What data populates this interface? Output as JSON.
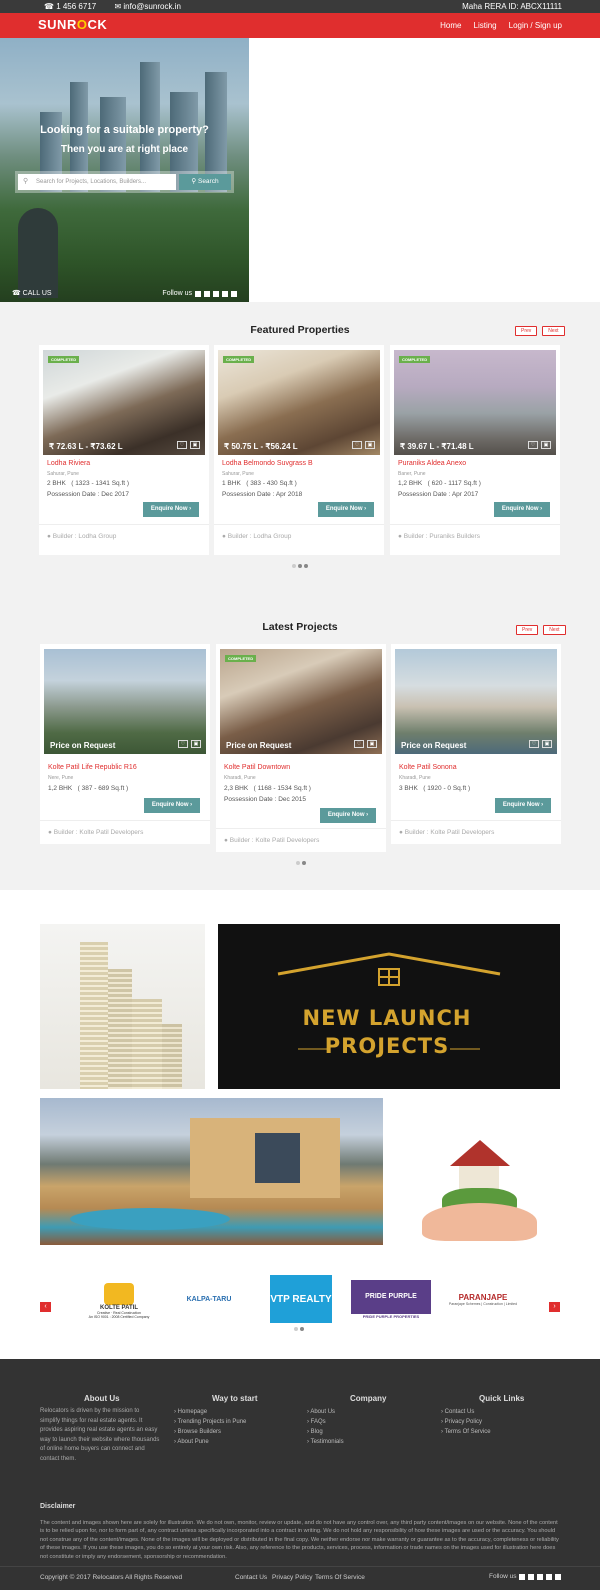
{
  "topbar": {
    "phone": "1 456 6717",
    "email": "info@sunrock.in",
    "rera": "Maha RERA ID: ABCX11111"
  },
  "nav": {
    "logo_pre": "SUNR",
    "logo_o": "O",
    "logo_post": "CK",
    "links": [
      "Home",
      "Listing",
      "Login / Sign up"
    ]
  },
  "hero": {
    "line1": "Looking for a suitable property?",
    "line2": "Then you are at right place",
    "search_placeholder": "Search for Projects, Locations, Builders...",
    "search_btn": "Search",
    "call_us": "CALL US",
    "follow_us": "Follow us"
  },
  "featured": {
    "title": "Featured Properties",
    "prev": "Prev",
    "next": "Next",
    "cards": [
      {
        "badge": "COMPLETED",
        "price": "₹ 72.63 L - ₹73.62 L",
        "name": "Lodha Riviera",
        "location": "Sahurar, Pune",
        "config": "2 BHK",
        "area": "( 1323 - 1341 Sq.ft )",
        "possession": "Possession Date : Dec 2017",
        "enquire": "Enquire Now",
        "builder": "Builder : Lodha Group"
      },
      {
        "badge": "COMPLETED",
        "price": "₹ 50.75 L - ₹56.24 L",
        "name": "Lodha Belmondo Suvgrass B",
        "location": "Sahurar, Pune",
        "config": "1 BHK",
        "area": "( 383 - 430 Sq.ft )",
        "possession": "Possession Date : Apr 2018",
        "enquire": "Enquire Now",
        "builder": "Builder : Lodha Group"
      },
      {
        "badge": "COMPLETED",
        "price": "₹ 39.67 L - ₹71.48 L",
        "name": "Puraniks Aldea Anexo",
        "location": "Baner, Pune",
        "config": "1,2 BHK",
        "area": "( 620 - 1117 Sq.ft )",
        "possession": "Possession Date : Apr 2017",
        "enquire": "Enquire Now",
        "builder": "Builder : Puraniks Builders"
      }
    ]
  },
  "latest": {
    "title": "Latest Projects",
    "prev": "Prev",
    "next": "Next",
    "cards": [
      {
        "price": "Price on Request",
        "name": "Kolte Patil Life Republic R16",
        "location": "Nere, Pune",
        "config": "1,2 BHK",
        "area": "( 387 - 689 Sq.ft )",
        "enquire": "Enquire Now",
        "builder": "Builder : Kolte Patil Developers"
      },
      {
        "badge": "COMPLETED",
        "price": "Price on Request",
        "name": "Kolte Patil Downtown",
        "location": "Kharadi, Pune",
        "config": "2,3 BHK",
        "area": "( 1168 - 1534 Sq.ft )",
        "possession": "Possession Date : Dec 2015",
        "enquire": "Enquire Now",
        "builder": "Builder : Kolte Patil Developers"
      },
      {
        "price": "Price on Request",
        "name": "Kolte Patil Sonona",
        "location": "Kharadi, Pune",
        "config": "3 BHK",
        "area": "( 1920 - 0 Sq.ft )",
        "enquire": "Enquire Now",
        "builder": "Builder : Kolte Patil Developers"
      }
    ]
  },
  "banners": {
    "launch_line1": "NEW LAUNCH",
    "launch_line2": "PROJECTS"
  },
  "partners": [
    "KOLTE PATIL",
    "KALPA-TARU",
    "VTP REALTY",
    "PRIDE PURPLE",
    "PARANJAPE"
  ],
  "partner_sub": {
    "kolte": "Creative · Real Construction",
    "kolte_iso": "An ISO 9001 : 2008 Certified Company",
    "vtp": "REALTY",
    "pride": "PRIDE PURPLE PROPERTIES",
    "paranjape": "Paranjape Schemes | Construction | Limited"
  },
  "footer": {
    "about_title": "About Us",
    "about_text": "Relocators is driven by the mission to simplify things for real estate agents. It provides aspiring real estate agents an easy way to launch their website where thousands of online home buyers can connect and contact them.",
    "way_title": "Way to start",
    "way": [
      "Homepage",
      "Trending Projects in Pune",
      "Browse Builders",
      "About Pune"
    ],
    "company_title": "Company",
    "company": [
      "About Us",
      "FAQs",
      "Blog",
      "Testimonials"
    ],
    "quick_title": "Quick Links",
    "quick": [
      "Contact Us",
      "Privacy Policy",
      "Terms Of Service"
    ],
    "disclaimer_title": "Disclaimer",
    "disclaimer_text": "The content and images shown here are solely for illustration. We do not own, monitor, review or update, and do not have any control over, any third party content/images on our website. None of the content is to be relied upon for, nor to form part of, any contract unless specifically incorporated into a contract in writing. We do not hold any responsibility of how these images are used or the accuracy. You should not construe any of the content/images. None of the images will be deployed or distributed in the final copy. We neither endorse nor make warranty or guarantee as to the accuracy, completeness or reliability of these images. If you use these images, you do so entirely at your own risk. Also, any reference to the products, services, process, information or trade names on the images used for illustration here does not constitute or imply any endorsement, sponsorship or recommendation.",
    "copyright": "Copyright © 2017 Relocators All Rights Reserved",
    "bottom_links": [
      "Contact Us",
      "Privacy Policy",
      "Terms Of Service"
    ],
    "follow": "Follow us"
  }
}
